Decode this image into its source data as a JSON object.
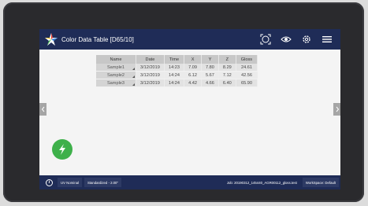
{
  "header": {
    "title": "Color Data Table [D65/10]"
  },
  "table": {
    "columns": [
      "Name",
      "Date",
      "Time",
      "X",
      "Y",
      "Z",
      "Gloss"
    ],
    "rows": [
      [
        "Sample1",
        "3/12/2019",
        "14:23",
        "7.09",
        "7.80",
        "8.29",
        "24.61"
      ],
      [
        "Sample2",
        "3/12/2019",
        "14:24",
        "6.12",
        "5.67",
        "7.12",
        "42.56"
      ],
      [
        "Sample3",
        "3/12/2019",
        "14:24",
        "4.42",
        "4.66",
        "6.40",
        "65.90"
      ]
    ]
  },
  "statusbar": {
    "uv": "UV Nominal",
    "standardized": "Standardized - 2.00\"",
    "job": "Job: 20190312_145440_AGR00112_gloss.test",
    "workspace": "WorkSpace: Default"
  },
  "colors": {
    "bar": "#1f2c57",
    "flash": "#3eb04a"
  }
}
